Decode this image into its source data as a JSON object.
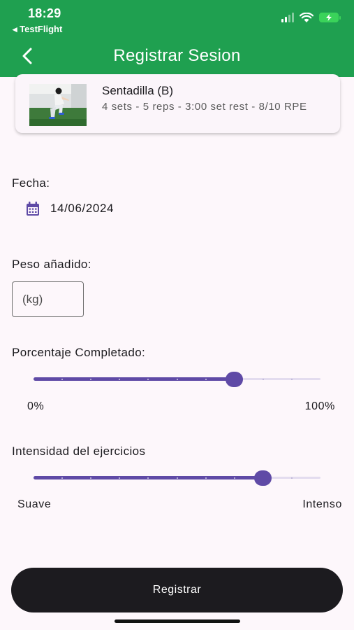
{
  "status_bar": {
    "time": "18:29",
    "back_app": "◂ TestFlight"
  },
  "header": {
    "title": "Registrar Sesion",
    "color": "#1fa050"
  },
  "exercise": {
    "name": "Sentadilla (B)",
    "details": "4 sets - 5 reps - 3:00 set rest - 8/10 RPE"
  },
  "date": {
    "label": "Fecha:",
    "value": "14/06/2024"
  },
  "weight": {
    "label": "Peso añadido:",
    "placeholder": "(kg)"
  },
  "completion": {
    "label": "Porcentaje Completado:",
    "min_label": "0%",
    "max_label": "100%",
    "value": 0.7,
    "divisions": 10
  },
  "intensity": {
    "label": "Intensidad del ejercicios",
    "min_label": "Suave",
    "max_label": "Intenso",
    "value": 0.8,
    "divisions": 10
  },
  "submit": {
    "label": "Registrar"
  },
  "colors": {
    "accent": "#5f4aa6",
    "track_inactive": "#e3dcef",
    "button": "#1c1b1f"
  }
}
